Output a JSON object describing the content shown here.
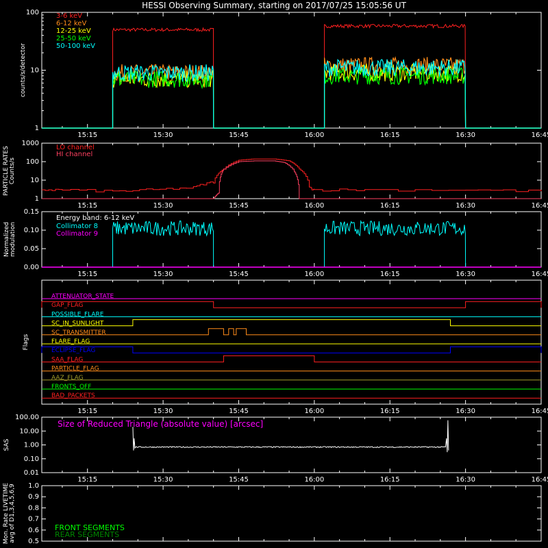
{
  "title": "HESSI Observing Summary, starting on 2017/07/25 15:05:56 UT",
  "time_ticks": [
    "15:15",
    "15:30",
    "15:45",
    "16:00",
    "16:15",
    "16:30",
    "16:45"
  ],
  "colors": {
    "background": "#000000",
    "axes": "#ffffff",
    "red": "#ff2020",
    "orange": "#ff8c1a",
    "yellow": "#ffff00",
    "green": "#00ff00",
    "cyan": "#00ffff",
    "magenta": "#ff00ff",
    "blue": "#0000ff",
    "olive": "#a09a2a",
    "pink": "#ff4060"
  },
  "chart_data": [
    {
      "type": "line",
      "panel": "count_rates",
      "ylabel": "counts/s/detector",
      "yscale": "log",
      "ylim": [
        1,
        100
      ],
      "yticks": [
        "1",
        "10",
        "100"
      ],
      "xlim": [
        "15:05:56",
        "16:45"
      ],
      "data_intervals": [
        [
          "15:20:00",
          "15:40:00"
        ],
        [
          "16:02:00",
          "16:30:00"
        ]
      ],
      "background_level": 1,
      "series": [
        {
          "name": "3-6 keV",
          "color": "#ff2020",
          "levels": [
            50,
            58
          ]
        },
        {
          "name": "6-12 keV",
          "color": "#ff8c1a",
          "levels": [
            9,
            12
          ]
        },
        {
          "name": "12-25 keV",
          "color": "#ffff00",
          "levels": [
            7,
            9
          ]
        },
        {
          "name": "25-50 keV",
          "color": "#00ff00",
          "levels": [
            7,
            8
          ]
        },
        {
          "name": "50-100 keV",
          "color": "#00ffff",
          "levels": [
            9,
            11
          ]
        }
      ]
    },
    {
      "type": "line",
      "panel": "particle_rates",
      "ylabel": "PARTICLE RATES Counts/s",
      "yscale": "log",
      "ylim": [
        1,
        1000
      ],
      "yticks": [
        "1",
        "10",
        "100",
        "1000"
      ],
      "series": [
        {
          "name": "LO channel",
          "color": "#ff2020",
          "x": [
            "15:05:56",
            "15:10",
            "15:20",
            "15:28",
            "15:36",
            "15:40",
            "15:42",
            "15:45",
            "15:48",
            "15:52",
            "15:55",
            "15:57",
            "15:59",
            "16:00",
            "16:10",
            "16:30",
            "16:45"
          ],
          "y": [
            3,
            3,
            2.5,
            3,
            4,
            8,
            40,
            120,
            140,
            140,
            110,
            40,
            4,
            3,
            3,
            3,
            2.5
          ]
        },
        {
          "name": "HI channel",
          "color": "#ff4060",
          "x": [
            "15:05:56",
            "15:40",
            "15:41",
            "15:42",
            "15:45",
            "15:48",
            "15:52",
            "15:54",
            "15:56",
            "15:57",
            "16:45"
          ],
          "y": [
            1,
            1,
            2,
            40,
            100,
            110,
            110,
            90,
            30,
            1,
            1
          ]
        }
      ]
    },
    {
      "type": "line",
      "panel": "modulation",
      "ylabel": "Normalized modulation",
      "ylim": [
        0,
        0.15
      ],
      "yticks": [
        "0.00",
        "0.05",
        "0.10",
        "0.15"
      ],
      "legend_header": "Energy band: 6-12 keV",
      "series": [
        {
          "name": "Collimator 8",
          "color": "#00ffff",
          "level": 0.105,
          "intervals": [
            [
              "15:20:00",
              "15:40:00"
            ],
            [
              "16:02:00",
              "16:30:00"
            ]
          ]
        },
        {
          "name": "Collimator 9",
          "color": "#ff00ff",
          "level": 0
        }
      ]
    },
    {
      "type": "line",
      "panel": "flags",
      "ylabel": "Flags",
      "flags": [
        {
          "name": "ATTENUATOR_STATE",
          "color": "#ff00ff",
          "on": []
        },
        {
          "name": "GAP_FLAG",
          "color": "#ff2020",
          "on": [
            [
              "15:05:56",
              "15:40:00"
            ],
            [
              "16:30:00",
              "16:45"
            ]
          ]
        },
        {
          "name": "POSSIBLE_FLARE",
          "color": "#00ffff",
          "on": []
        },
        {
          "name": "SC_IN_SUNLIGHT",
          "color": "#ffff00",
          "on": [
            [
              "15:24:00",
              "16:27:00"
            ]
          ]
        },
        {
          "name": "SC_TRANSMITTER",
          "color": "#ff8c1a",
          "on": [
            [
              "15:39:00",
              "15:42:00"
            ],
            [
              "15:43:00",
              "15:44:00"
            ],
            [
              "15:44:30",
              "15:46:30"
            ]
          ]
        },
        {
          "name": "FLARE_FLAG",
          "color": "#ffff00",
          "on": []
        },
        {
          "name": "ECLIPSE_FLAG",
          "color": "#0000ff",
          "on": [
            [
              "15:05:56",
              "15:24:00"
            ],
            [
              "16:27:00",
              "16:45"
            ]
          ]
        },
        {
          "name": "SAA_FLAG",
          "color": "#ff2020",
          "on": [
            [
              "15:42:00",
              "16:00:00"
            ]
          ]
        },
        {
          "name": "PARTICLE_FLAG",
          "color": "#ff8c1a",
          "on": []
        },
        {
          "name": "AAZ_FLAG",
          "color": "#a09a2a",
          "on": []
        },
        {
          "name": "FRONTS_OFF",
          "color": "#00ff00",
          "on": []
        },
        {
          "name": "BAD_PACKETS",
          "color": "#ff2020",
          "on": []
        }
      ]
    },
    {
      "type": "line",
      "panel": "sas",
      "ylabel": "SAS",
      "yscale": "log",
      "ylim": [
        0.01,
        100
      ],
      "yticks": [
        "0.01",
        "0.10",
        "1.00",
        "10.00",
        "100.00"
      ],
      "title": "Size of Reduced Triangle (absolute value) [arcsec]",
      "series": [
        {
          "name": "Size of Reduced Triangle (absolute value) [arcsec]",
          "color": "#ffffff",
          "x": [
            "15:24:00",
            "15:25:00",
            "15:45:00",
            "16:05:00",
            "16:26:30"
          ],
          "y": [
            0.75,
            0.7,
            0.7,
            0.72,
            0.75
          ]
        }
      ]
    },
    {
      "type": "line",
      "panel": "livetime",
      "ylabel": "Mon. Rate LIVETIME avg of D1,3,4,5,6,9",
      "ylim": [
        0.5,
        1.0
      ],
      "yticks": [
        "0.5",
        "0.6",
        "0.7",
        "0.8",
        "0.9",
        "1.0"
      ],
      "series": [
        {
          "name": "FRONT SEGMENTS",
          "color": "#00ff00"
        },
        {
          "name": "REAR SEGMENTS",
          "color": "#008800"
        }
      ]
    }
  ]
}
